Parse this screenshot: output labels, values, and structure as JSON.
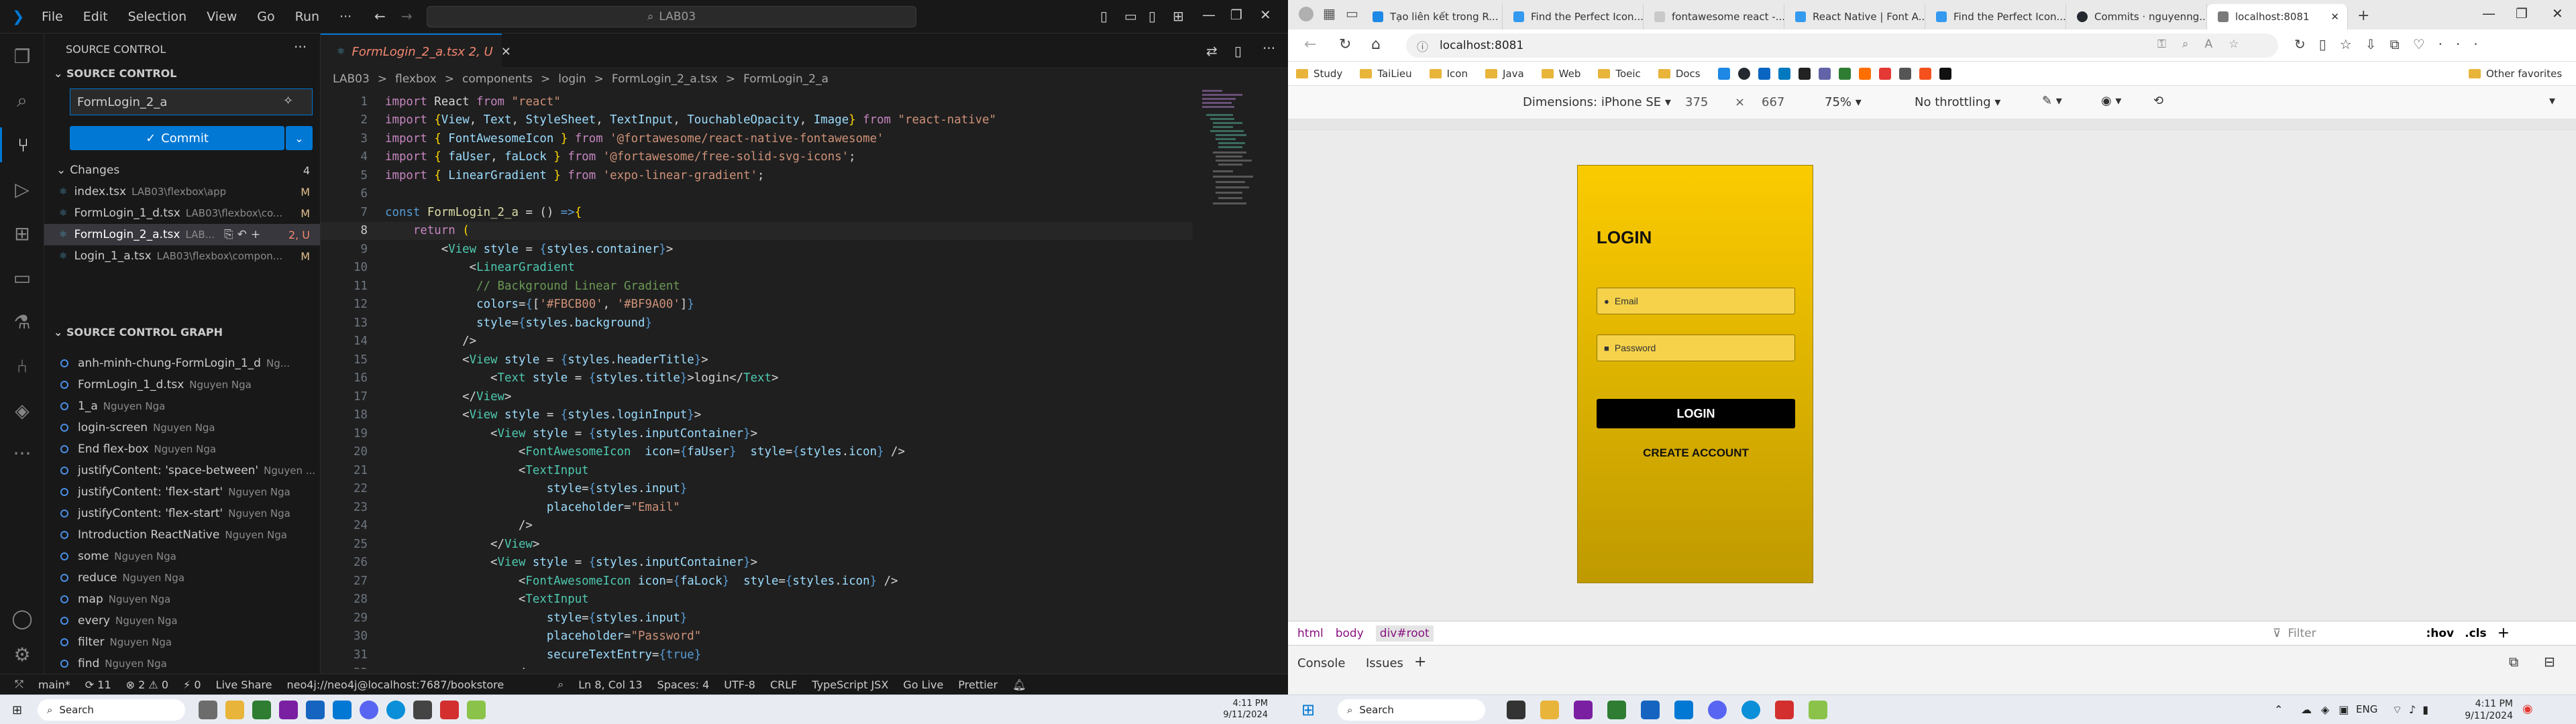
{
  "vscode": {
    "menu": [
      "File",
      "Edit",
      "Selection",
      "View",
      "Go",
      "Run",
      "···"
    ],
    "search": "LAB03",
    "side": {
      "header": "SOURCE CONTROL",
      "section": "SOURCE CONTROL",
      "message": "FormLogin_2_a",
      "commit": "Commit",
      "changes_label": "Changes",
      "changes_count": "4",
      "changes": [
        {
          "name": "index.tsx",
          "path": "LAB03\\flexbox\\app",
          "status": "M"
        },
        {
          "name": "FormLogin_1_d.tsx",
          "path": "LAB03\\flexbox\\co...",
          "status": "M"
        },
        {
          "name": "FormLogin_2_a.tsx",
          "path": "LAB...",
          "status": "2, U"
        },
        {
          "name": "Login_1_a.tsx",
          "path": "LAB03\\flexbox\\compon...",
          "status": "M"
        }
      ],
      "graph_header": "SOURCE CONTROL GRAPH",
      "graph": [
        {
          "msg": "anh-minh-chung-FormLogin_1_d",
          "author": "Ng..."
        },
        {
          "msg": "FormLogin_1_d.tsx",
          "author": "Nguyen Nga"
        },
        {
          "msg": "1_a",
          "author": "Nguyen Nga"
        },
        {
          "msg": "login-screen",
          "author": "Nguyen Nga"
        },
        {
          "msg": "End flex-box",
          "author": "Nguyen Nga"
        },
        {
          "msg": "justifyContent: 'space-between'",
          "author": "Nguyen ..."
        },
        {
          "msg": "justifyContent: 'flex-start'",
          "author": "Nguyen Nga"
        },
        {
          "msg": "justifyContent: 'flex-start'",
          "author": "Nguyen Nga"
        },
        {
          "msg": "Introduction ReactNative",
          "author": "Nguyen Nga"
        },
        {
          "msg": "some",
          "author": "Nguyen Nga"
        },
        {
          "msg": "reduce",
          "author": "Nguyen Nga"
        },
        {
          "msg": "map",
          "author": "Nguyen Nga"
        },
        {
          "msg": "every",
          "author": "Nguyen Nga"
        },
        {
          "msg": "filter",
          "author": "Nguyen Nga"
        },
        {
          "msg": "find",
          "author": "Nguyen Nga"
        }
      ]
    },
    "tab": "FormLogin_2_a.tsx 2, U",
    "breadcrumb": [
      "LAB03",
      ">",
      "flexbox",
      ">",
      "components",
      ">",
      "login",
      ">",
      "FormLogin_2_a.tsx",
      ">",
      "FormLogin_2_a"
    ],
    "status": {
      "branch": "main*",
      "sync": "⟳ 11",
      "problems": "⊗ 2 ⚠ 0",
      "ports": "⚡ 0",
      "liveshare": "Live Share",
      "db": "neo4j://neo4j@localhost:7687/bookstore",
      "pos": "Ln 8, Col 13",
      "spaces": "Spaces: 4",
      "enc": "UTF-8",
      "eol": "CRLF",
      "lang": "TypeScript JSX",
      "golive": "Go Live",
      "prettier": "Prettier"
    }
  },
  "edge": {
    "tabs": [
      "Tạo liên kết trong R...",
      "Find the Perfect Icon...",
      "fontawesome react -...",
      "React Native | Font A...",
      "Find the Perfect Icon...",
      "Commits · nguyenng...",
      "localhost:8081"
    ],
    "url": "localhost:8081",
    "favorites": [
      "Study",
      "TaiLieu",
      "Icon",
      "Java",
      "Web",
      "Toeic",
      "Docs"
    ],
    "other_fav": "Other favorites",
    "device": {
      "label": "Dimensions: iPhone SE",
      "width": "375",
      "x": "×",
      "height": "667",
      "zoom": "75%",
      "throttle": "No throttling"
    },
    "app": {
      "title": "LOGIN",
      "email": "Email",
      "password": "Password",
      "login": "LOGIN",
      "create": "CREATE ACCOUNT"
    },
    "crumbs": [
      "html",
      "body",
      "div#root"
    ],
    "filter": "Filter",
    "hov": ":hov",
    "cls": ".cls",
    "drawer": [
      "Console",
      "Issues"
    ]
  },
  "taskbar": {
    "search": "Search",
    "search2": "Search",
    "time": "4:11 PM",
    "date": "9/11/2024",
    "lang": "ENG"
  }
}
